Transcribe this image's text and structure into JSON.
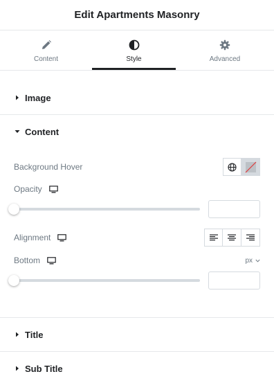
{
  "header": {
    "title": "Edit Apartments Masonry"
  },
  "tabs": [
    {
      "label": "Content",
      "icon": "pencil-icon",
      "active": false
    },
    {
      "label": "Style",
      "icon": "contrast-icon",
      "active": true
    },
    {
      "label": "Advanced",
      "icon": "gear-icon",
      "active": false
    }
  ],
  "sections": {
    "image": {
      "title": "Image",
      "expanded": false
    },
    "content": {
      "title": "Content",
      "expanded": true,
      "background_hover": {
        "label": "Background Hover"
      },
      "opacity": {
        "label": "Opacity",
        "value": "",
        "slider_fraction": 0
      },
      "alignment": {
        "label": "Alignment",
        "options": [
          "left",
          "center",
          "right"
        ]
      },
      "bottom": {
        "label": "Bottom",
        "unit": "px",
        "value": "",
        "slider_fraction": 0
      }
    },
    "title": {
      "title": "Title",
      "expanded": false
    },
    "sub_title": {
      "title": "Sub Title",
      "expanded": false
    }
  },
  "colors": {
    "text": "#1f2124",
    "muted": "#6d7882",
    "border": "#d5dadf",
    "clear_slash": "#e03b3b"
  }
}
